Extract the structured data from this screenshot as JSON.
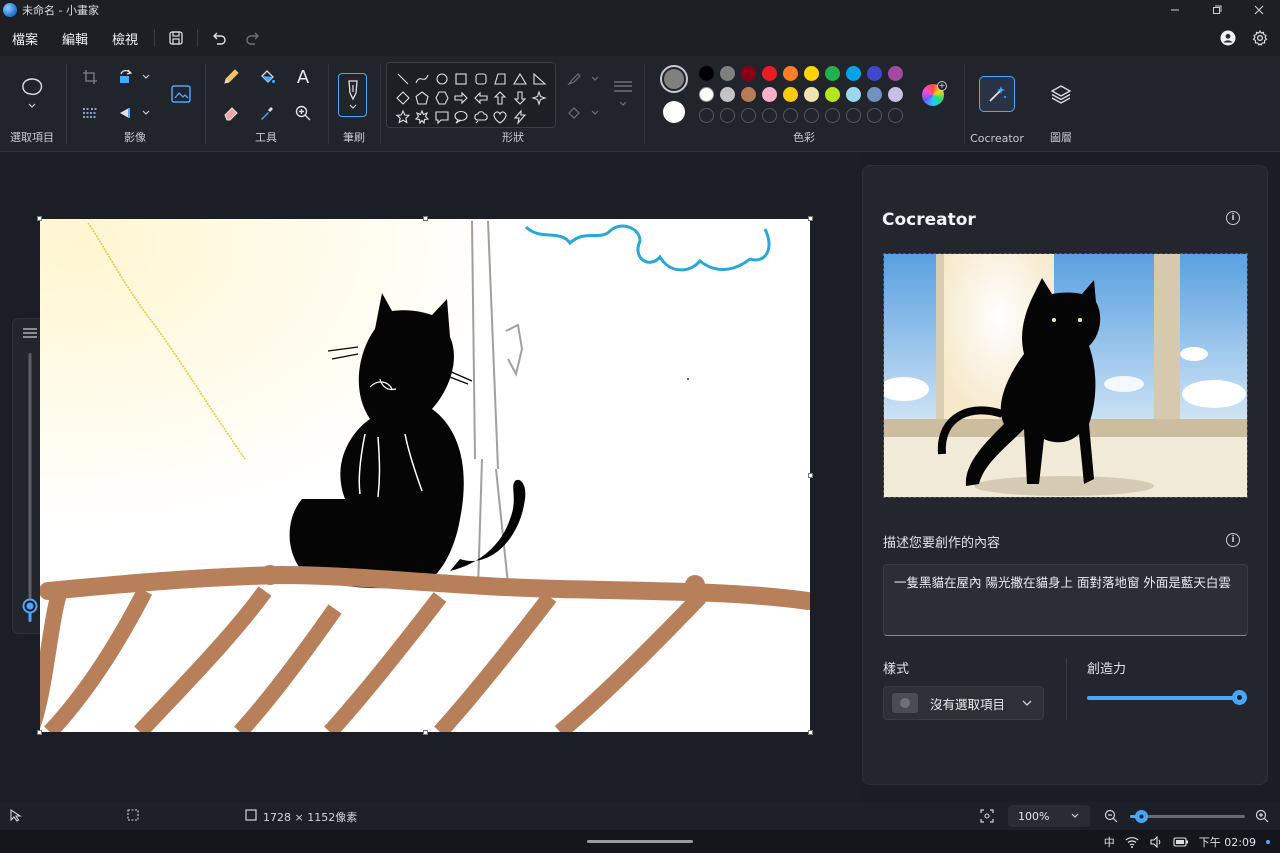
{
  "window": {
    "title": "未命名 - 小畫家",
    "controls": [
      "minimize",
      "restore",
      "close"
    ]
  },
  "menu": {
    "file": "檔案",
    "edit": "編輯",
    "view": "檢視"
  },
  "ribbon": {
    "select_label": "選取項目",
    "image_label": "影像",
    "tools_label": "工具",
    "brush_label": "筆刷",
    "shapes_label": "形狀",
    "colors_label": "色彩",
    "cocreator_label": "Cocreator",
    "layers_label": "圖層",
    "text_tool_glyph": "A"
  },
  "colors": {
    "primary": "#808080",
    "secondary": "#ffffff",
    "row1": [
      "#000000",
      "#7f7f7f",
      "#880015",
      "#ed1c24",
      "#ff7f27",
      "#ffd400",
      "#22b14c",
      "#00a2e8",
      "#3f48cc",
      "#a349a4"
    ],
    "row2": [
      "#ffffff",
      "#c3c3c3",
      "#b97a57",
      "#ffaec9",
      "#ffc90e",
      "#efe4b0",
      "#b5e61d",
      "#99d9ea",
      "#7092be",
      "#c8bfe7"
    ],
    "accent": "#4aa8ff"
  },
  "panel": {
    "title": "Cocreator",
    "prompt_label": "描述您要創作的內容",
    "prompt_text": "一隻黑貓在屋內 陽光撒在貓身上 面對落地窗 外面是藍天白雲",
    "style_label": "樣式",
    "style_value": "沒有選取項目",
    "creativity_label": "創造力",
    "creativity_value": 1.0
  },
  "status": {
    "canvas_size": "1728 × 1152像素",
    "zoom": "100%"
  },
  "taskbar": {
    "ime": "中",
    "time": "下午 02:09"
  }
}
